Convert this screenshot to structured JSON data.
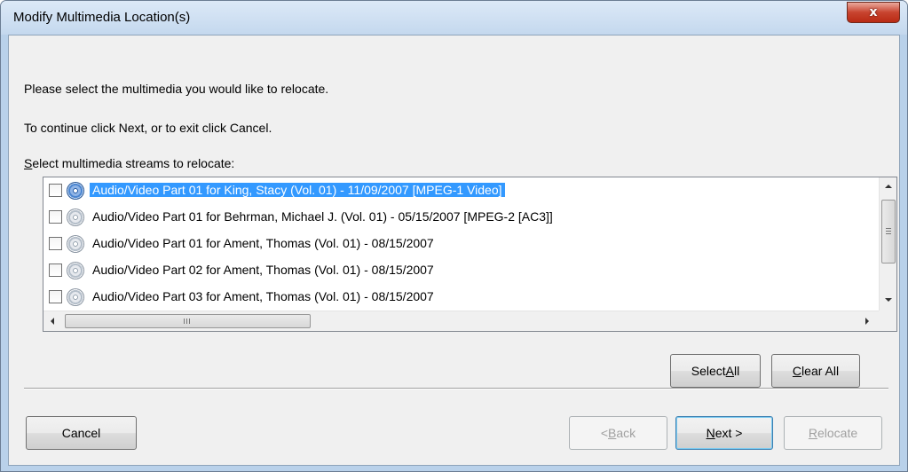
{
  "window": {
    "title": "Modify Multimedia Location(s)",
    "close_glyph": "x"
  },
  "instructions": {
    "line1": "Please select the multimedia you would like to relocate.",
    "line2": "To continue click Next, or to exit click Cancel.",
    "list_label_accel": "S",
    "list_label_rest": "elect multimedia streams to relocate:"
  },
  "streams": [
    {
      "label": "Audio/Video Part 01 for King, Stacy (Vol. 01) - 11/09/2007 [MPEG-1 Video]",
      "checked": false,
      "selected": true
    },
    {
      "label": "Audio/Video Part 01 for Behrman, Michael J. (Vol. 01) - 05/15/2007 [MPEG-2 [AC3]]",
      "checked": false,
      "selected": false
    },
    {
      "label": "Audio/Video Part 01 for Ament, Thomas (Vol. 01) - 08/15/2007",
      "checked": false,
      "selected": false
    },
    {
      "label": "Audio/Video Part 02 for Ament, Thomas (Vol. 01) - 08/15/2007",
      "checked": false,
      "selected": false
    },
    {
      "label": "Audio/Video Part 03 for Ament, Thomas (Vol. 01) - 08/15/2007",
      "checked": false,
      "selected": false
    }
  ],
  "buttons": {
    "select_all_pre": "Select ",
    "select_all_accel": "A",
    "select_all_post": "ll",
    "clear_all_accel": "C",
    "clear_all_post": "lear All",
    "cancel": "Cancel",
    "back_pre": "< ",
    "back_accel": "B",
    "back_post": "ack",
    "next_accel": "N",
    "next_post": "ext >",
    "relocate_accel": "R",
    "relocate_post": "elocate"
  },
  "button_states": {
    "back_enabled": false,
    "relocate_enabled": false
  },
  "icons": {
    "row_icon": "disc-icon",
    "scroll_up": "scroll-up-arrow-icon",
    "scroll_down": "scroll-down-arrow-icon",
    "scroll_left": "scroll-left-arrow-icon",
    "scroll_right": "scroll-right-arrow-icon"
  },
  "colors": {
    "selection": "#3399ff",
    "title_bar": "#c4d8ee",
    "close_button": "#c8442f"
  }
}
